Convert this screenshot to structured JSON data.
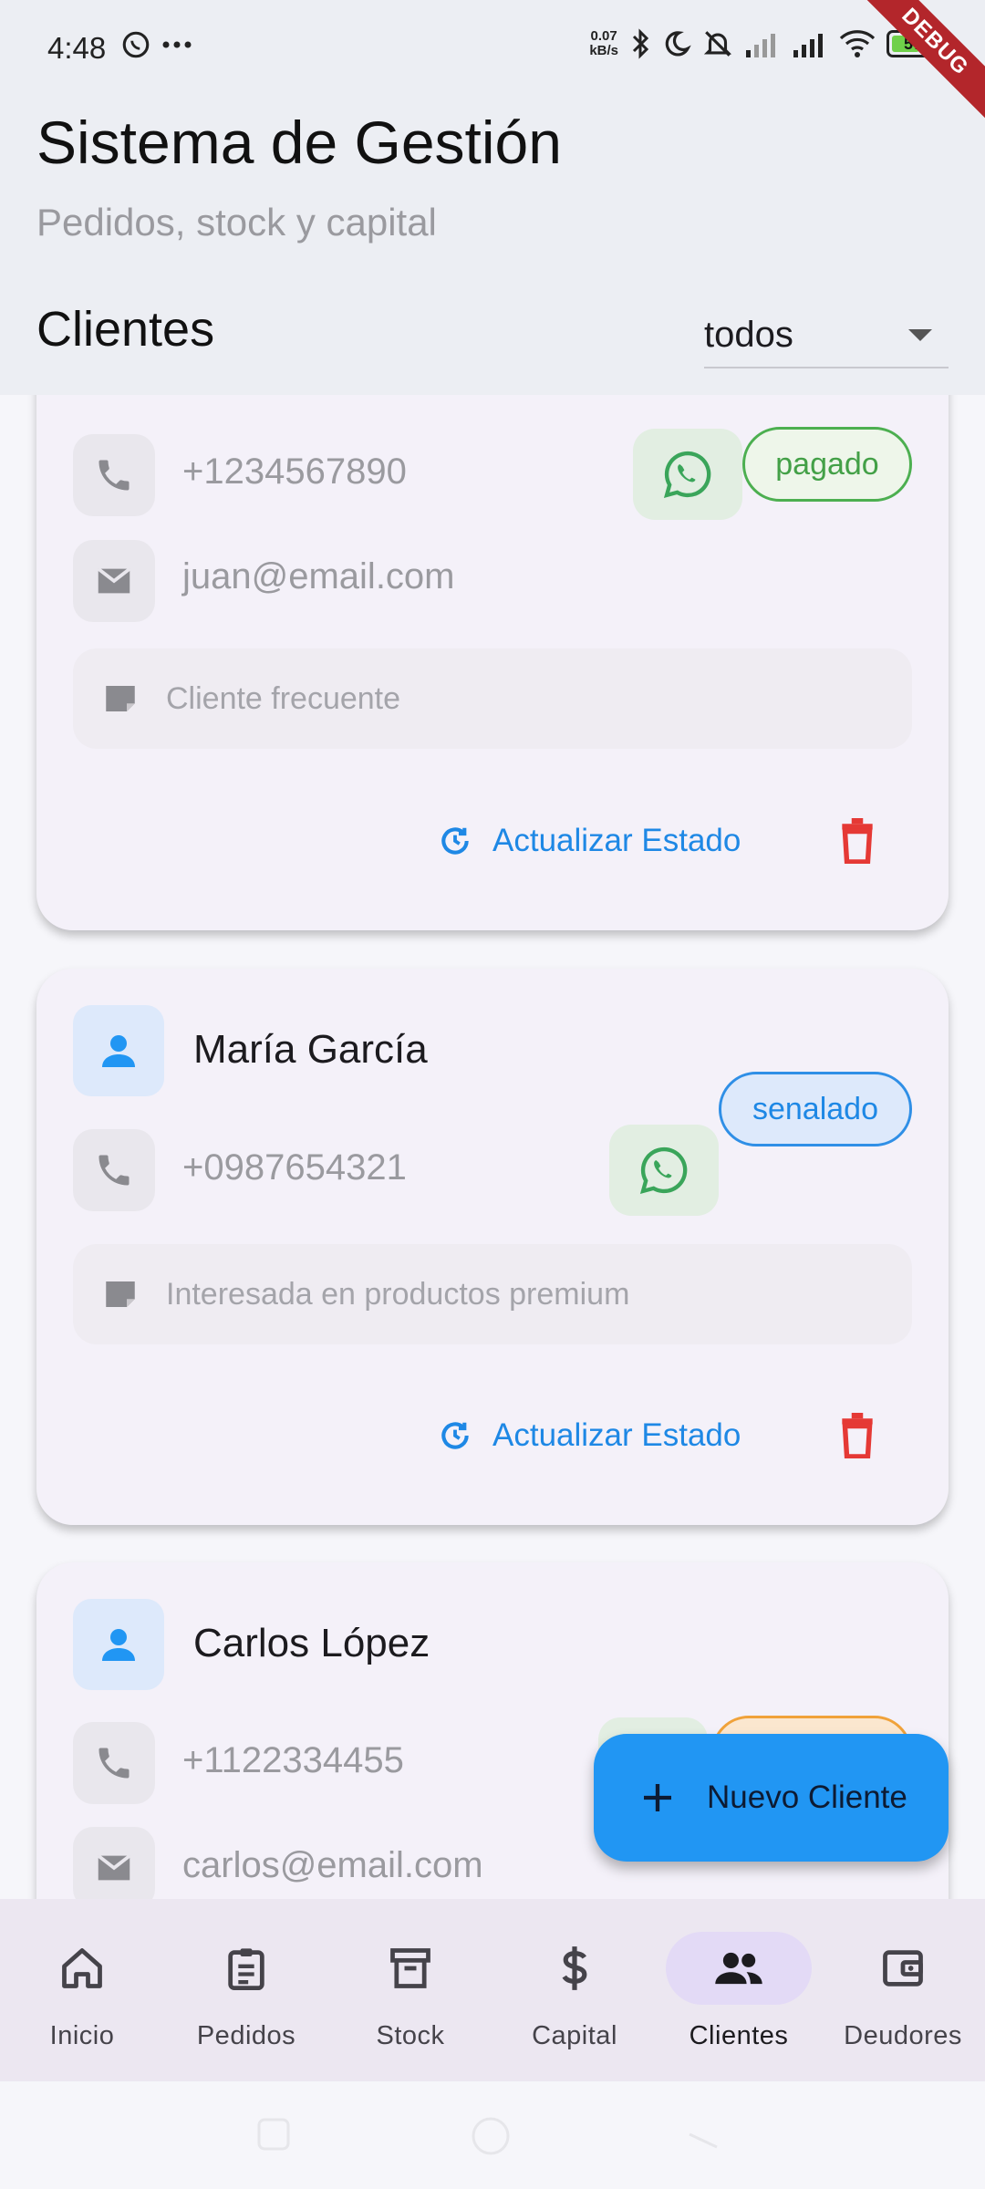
{
  "status_bar": {
    "time": "4:48",
    "net_speed_value": "0.07",
    "net_speed_unit": "kB/s",
    "battery": "57"
  },
  "debug_label": "DEBUG",
  "header": {
    "title": "Sistema de Gestión",
    "subtitle": "Pedidos, stock y capital",
    "section": "Clientes",
    "filter_value": "todos"
  },
  "clients": [
    {
      "phone": "+1234567890",
      "email": "juan@email.com",
      "note": "Cliente frecuente",
      "status": "pagado"
    },
    {
      "name": "María García",
      "phone": "+0987654321",
      "note": "Interesada en productos premium",
      "status": "senalado"
    },
    {
      "name": "Carlos López",
      "phone": "+1122334455",
      "email": "carlos@email.com"
    }
  ],
  "actions": {
    "update_label": "Actualizar Estado"
  },
  "fab": {
    "label": "Nuevo Cliente"
  },
  "nav": {
    "items": [
      {
        "label": "Inicio",
        "icon": "home-icon"
      },
      {
        "label": "Pedidos",
        "icon": "clipboard-icon"
      },
      {
        "label": "Stock",
        "icon": "archive-icon"
      },
      {
        "label": "Capital",
        "icon": "dollar-icon"
      },
      {
        "label": "Clientes",
        "icon": "people-icon",
        "active": true
      },
      {
        "label": "Deudores",
        "icon": "wallet-icon"
      }
    ]
  },
  "colors": {
    "accent": "#2196f3",
    "paid": "#43a047",
    "signed": "#1e88e5",
    "pending": "#f0a23a",
    "delete": "#e53935"
  }
}
